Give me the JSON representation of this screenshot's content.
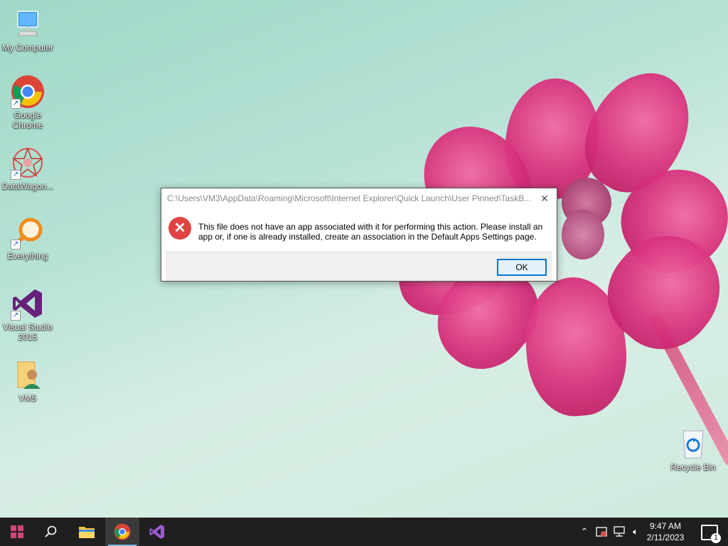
{
  "desktop": {
    "icons": [
      {
        "label": "My Computer",
        "icon": "monitor-icon"
      },
      {
        "label": "Google Chrome",
        "icon": "chrome-icon"
      },
      {
        "label": "DataWagon...",
        "icon": "datawagon-icon"
      },
      {
        "label": "Everything",
        "icon": "magnifier-icon"
      },
      {
        "label": "Visual Studio 2015",
        "icon": "visual-studio-icon"
      },
      {
        "label": "VM5",
        "icon": "user-folder-icon"
      },
      {
        "label": "Recycle Bin",
        "icon": "recycle-bin-icon"
      }
    ]
  },
  "dialog": {
    "title": "C:\\Users\\VM3\\AppData\\Roaming\\Microsoft\\Internet Explorer\\Quick Launch\\User Pinned\\TaskB...",
    "close": "✕",
    "message": "This file does not have an app associated with it for performing this action. Please install an app or, if one is already installed, create an association in the Default Apps Settings page.",
    "ok": "OK"
  },
  "taskbar": {
    "clock_time": "9:47 AM",
    "clock_date": "2/11/2023",
    "notification_count": "1"
  },
  "colors": {
    "accent": "#0078d7",
    "taskbar": "#1f1f1f",
    "error": "#e04343"
  }
}
